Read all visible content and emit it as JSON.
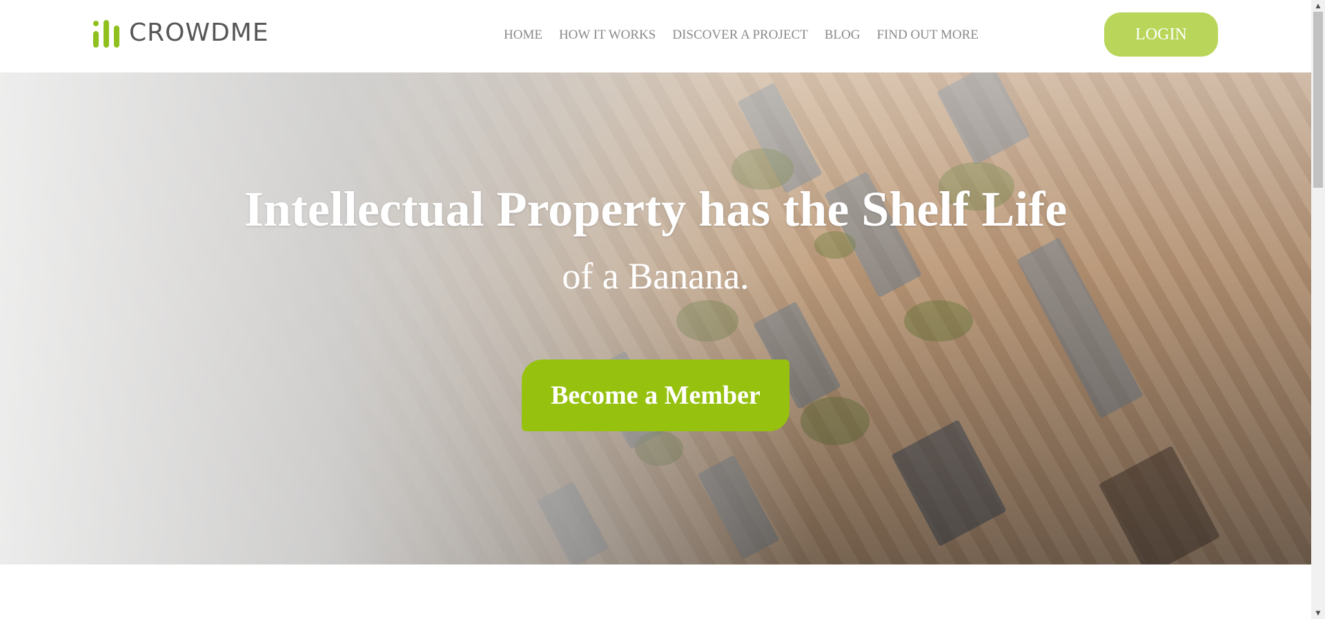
{
  "brand": {
    "name": "CROWDME",
    "logo_icon": "bar-chart-logo-icon",
    "accent": "#8fc01e"
  },
  "nav": {
    "items": [
      "HOME",
      "HOW IT WORKS",
      "DISCOVER A PROJECT",
      "BLOG",
      "FIND OUT MORE"
    ]
  },
  "header": {
    "login_label": "LOGIN",
    "login_color": "#b9d65a"
  },
  "hero": {
    "title": "Intellectual Property has the Shelf Life",
    "subtitle": "of a Banana.",
    "cta_label": "Become a Member",
    "cta_color": "#97c10f"
  },
  "scrollbar": {
    "up_icon": "scroll-up-arrow-icon",
    "down_icon": "scroll-down-arrow-icon"
  }
}
